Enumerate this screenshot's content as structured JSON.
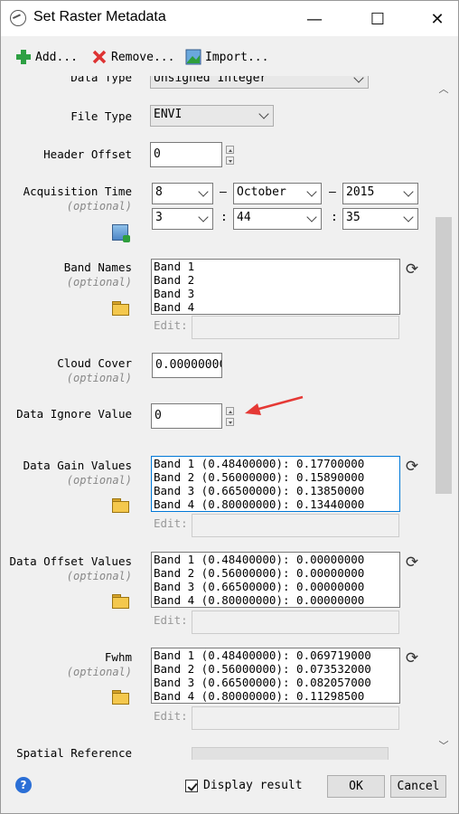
{
  "window": {
    "title": "Set Raster Metadata",
    "minimize": "—",
    "maximize": "☐",
    "close": "✕"
  },
  "toolbar": {
    "add_label": "Add...",
    "remove_label": "Remove...",
    "import_label": "Import..."
  },
  "form": {
    "data_type": {
      "label": "Data Type",
      "value": "Unsigned Integer"
    },
    "file_type": {
      "label": "File Type",
      "value": "ENVI"
    },
    "header_offset": {
      "label": "Header Offset",
      "value": "0"
    },
    "acquisition_time": {
      "label": "Acquisition Time",
      "optional": "(optional)",
      "day": "8",
      "month": "October",
      "year": "2015",
      "hour": "3",
      "minute": "44",
      "second": "35",
      "dash1": "–",
      "dash2": "–",
      "colon1": ":",
      "colon2": ":"
    },
    "band_names": {
      "label": "Band Names",
      "optional": "(optional)",
      "items": "Band 1\nBand 2\nBand 3\nBand 4",
      "edit_label": "Edit:"
    },
    "cloud_cover": {
      "label": "Cloud Cover",
      "optional": "(optional)",
      "value": "0.0000000C"
    },
    "data_ignore": {
      "label": "Data Ignore Value",
      "value": "0"
    },
    "gain": {
      "label": "Data Gain Values",
      "optional": "(optional)",
      "items": "Band 1 (0.48400000): 0.17700000\nBand 2 (0.56000000): 0.15890000\nBand 3 (0.66500000): 0.13850000\nBand 4 (0.80000000): 0.13440000",
      "edit_label": "Edit:"
    },
    "offset": {
      "label": "Data Offset Values",
      "optional": "(optional)",
      "items": "Band 1 (0.48400000): 0.00000000\nBand 2 (0.56000000): 0.00000000\nBand 3 (0.66500000): 0.00000000\nBand 4 (0.80000000): 0.00000000",
      "edit_label": "Edit:"
    },
    "fwhm": {
      "label": "Fwhm",
      "optional": "(optional)",
      "items": "Band 1 (0.48400000): 0.069719000\nBand 2 (0.56000000): 0.073532000\nBand 3 (0.66500000): 0.082057000\nBand 4 (0.80000000): 0.11298500",
      "edit_label": "Edit:"
    },
    "spatial_reference": {
      "label": "Spatial Reference"
    }
  },
  "footer": {
    "help": "?",
    "display_result_label": "Display result",
    "display_result_checked": true,
    "ok_label": "OK",
    "cancel_label": "Cancel"
  },
  "colors": {
    "accent_arrow": "#e53935",
    "focus_border": "#0078d7"
  }
}
